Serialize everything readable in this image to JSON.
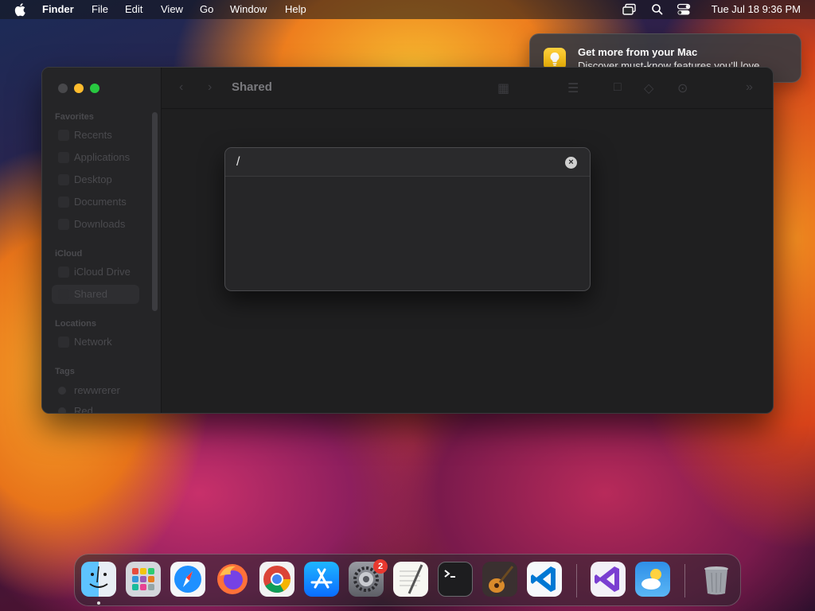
{
  "menubar": {
    "app_name": "Finder",
    "menus": [
      "File",
      "Edit",
      "View",
      "Go",
      "Window",
      "Help"
    ],
    "clock": "Tue Jul 18  9:36 PM",
    "status_icons": [
      "screen-mirroring-icon",
      "search-icon",
      "control-center-icon"
    ]
  },
  "notification": {
    "title": "Get more from your Mac",
    "body": "Discover must-know features you’ll love.",
    "icon": "lightbulb-icon",
    "accent": "#f4b400"
  },
  "finder": {
    "title": "Shared",
    "sidebar": {
      "favorites_label": "Favorites",
      "favorites": [
        "Recents",
        "Applications",
        "Desktop",
        "Documents",
        "Downloads"
      ],
      "icloud_label": "iCloud",
      "icloud": [
        "iCloud Drive",
        "Shared"
      ],
      "locations_label": "Locations",
      "locations": [
        "Network"
      ],
      "tags_label": "Tags",
      "tags": [
        "rewwrerer",
        "Red"
      ]
    }
  },
  "goto_dialog": {
    "value": "/",
    "clear_icon": "clear-icon"
  },
  "dock": {
    "apps": [
      "Finder",
      "Launchpad",
      "Safari",
      "Firefox",
      "Chrome",
      "App Store",
      "System Settings",
      "TextEdit",
      "Terminal",
      "GarageBand",
      "Visual Studio Code",
      "Visual Studio",
      "Weather",
      "Trash"
    ],
    "settings_badge": "2"
  },
  "colors": {
    "close": "#ff5f57",
    "minimize": "#febc2e",
    "zoom": "#28c840"
  }
}
